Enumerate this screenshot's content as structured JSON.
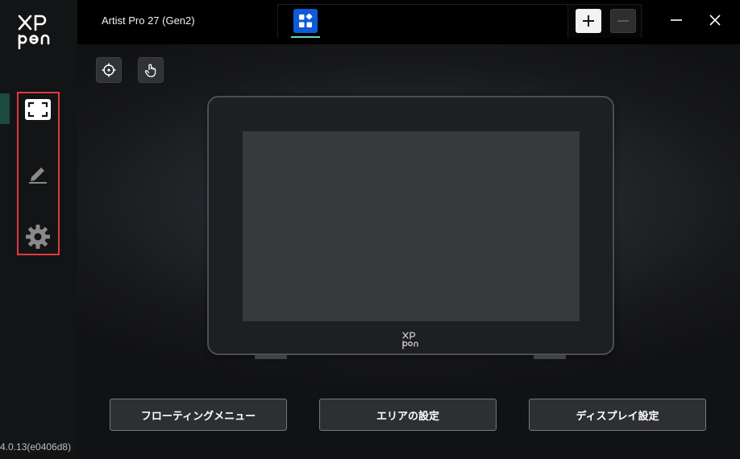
{
  "app": {
    "version": "4.0.13(e0406d8)",
    "device_name": "Artist Pro 27 (Gen2)"
  },
  "sidebar": {
    "items": [
      {
        "icon": "work-area-icon",
        "active": true
      },
      {
        "icon": "pen-icon",
        "active": false
      },
      {
        "icon": "gear-icon",
        "active": false
      }
    ]
  },
  "tabs": {
    "items": [
      {
        "icon": "app-grid-icon",
        "active": true
      }
    ],
    "add_icon": "plus-icon",
    "remove_icon": "minus-icon"
  },
  "window": {
    "minimize_icon": "minimize-icon",
    "close_icon": "close-icon"
  },
  "toolbar": {
    "items": [
      {
        "icon": "crosshair-icon"
      },
      {
        "icon": "touch-icon"
      }
    ]
  },
  "buttons": {
    "floating_menu": "フローティングメニュー",
    "area_settings": "エリアの設定",
    "display_settings": "ディスプレイ設定"
  },
  "colors": {
    "accent": "#6dd3c8",
    "app_tab_blue": "#0e5ad8",
    "highlight_red": "#e0393e",
    "active_bar": "#1c4a3d"
  }
}
